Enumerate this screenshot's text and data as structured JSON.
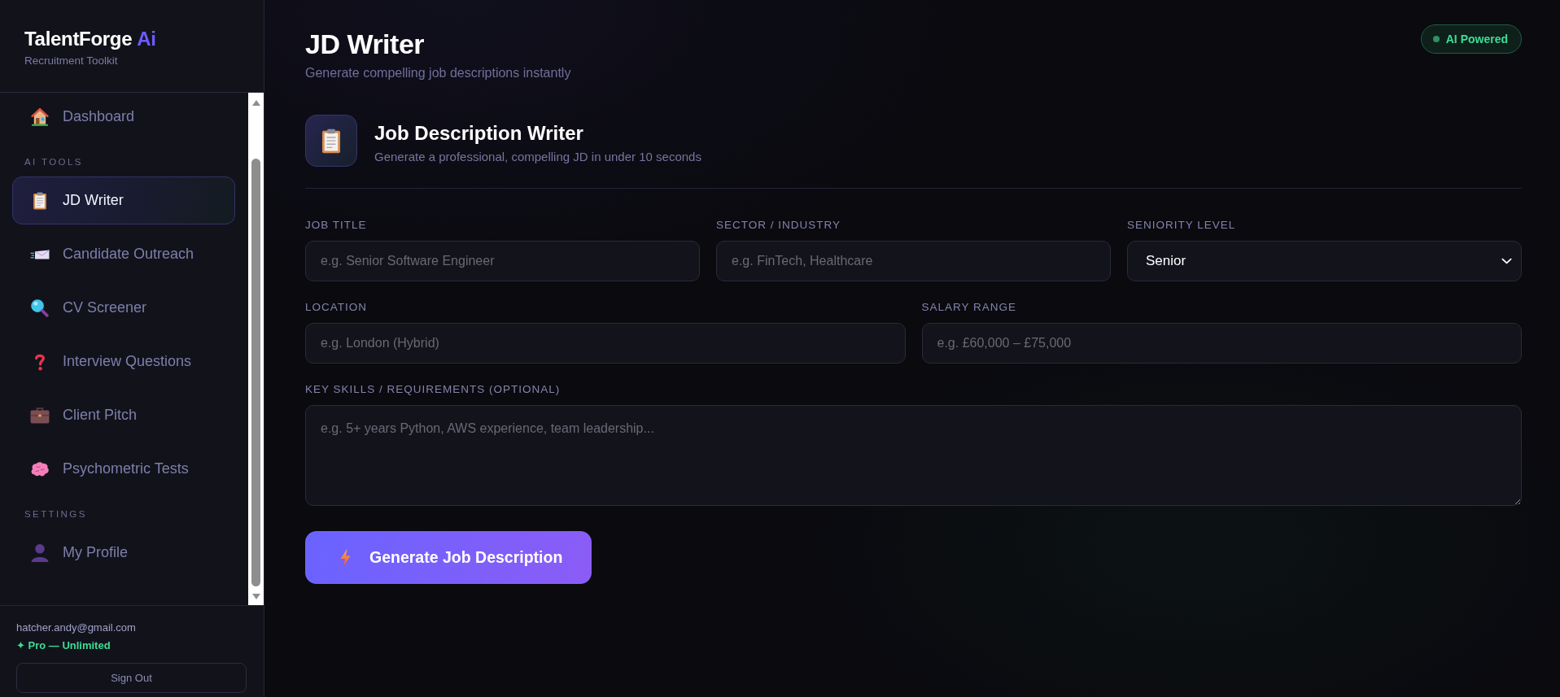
{
  "sidebar": {
    "brand": {
      "name": "TalentForge",
      "accent": "Ai"
    },
    "tagline": "Recruitment Toolkit",
    "nav": [
      {
        "items": [
          {
            "label": "Dashboard",
            "selected": false
          }
        ]
      },
      {
        "heading": "AI TOOLS",
        "items": [
          {
            "label": "JD Writer",
            "selected": true
          },
          {
            "label": "Candidate Outreach",
            "selected": false
          },
          {
            "label": "CV Screener",
            "selected": false
          },
          {
            "label": "Interview Questions",
            "selected": false
          },
          {
            "label": "Client Pitch",
            "selected": false
          },
          {
            "label": "Psychometric Tests",
            "selected": false
          }
        ]
      },
      {
        "heading": "SETTINGS",
        "items": [
          {
            "label": "My Profile",
            "selected": false
          }
        ]
      }
    ],
    "account": {
      "email": "hatcher.andy@gmail.com",
      "plan": "✦ Pro — Unlimited"
    },
    "sign_out": "Sign Out"
  },
  "header": {
    "title": "JD Writer",
    "subtitle": "Generate compelling job descriptions instantly",
    "badge": "AI Powered"
  },
  "tool": {
    "title": "Job Description Writer",
    "subtitle": "Generate a professional, compelling JD in under 10 seconds"
  },
  "form": {
    "rows": [
      [
        {
          "kind": "input",
          "label": "JOB TITLE",
          "placeholder": "e.g. Senior Software Engineer"
        },
        {
          "kind": "input",
          "label": "SECTOR / INDUSTRY",
          "placeholder": "e.g. FinTech, Healthcare"
        },
        {
          "kind": "select",
          "label": "SENIORITY LEVEL",
          "value": "Senior"
        }
      ],
      [
        {
          "kind": "input",
          "label": "LOCATION",
          "placeholder": "e.g. London (Hybrid)"
        },
        {
          "kind": "input",
          "label": "SALARY RANGE",
          "placeholder": "e.g. £60,000 – £75,000"
        }
      ],
      [
        {
          "kind": "textarea",
          "label": "KEY SKILLS / REQUIREMENTS (OPTIONAL)",
          "placeholder": "e.g. 5+ years Python, AWS experience, team leadership..."
        }
      ]
    ],
    "submit": "Generate Job Description"
  }
}
